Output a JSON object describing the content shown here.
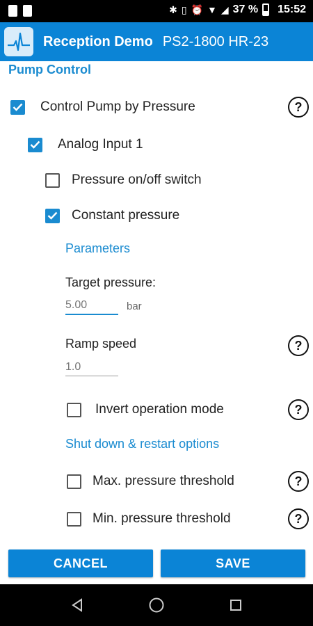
{
  "status_bar": {
    "battery": "37 %",
    "time": "15:52"
  },
  "app_bar": {
    "title": "Reception Demo",
    "device": "PS2-1800 HR-23"
  },
  "section_title": "Pump Control",
  "options": {
    "control_pump_by_pressure": {
      "label": "Control Pump by Pressure",
      "checked": true
    },
    "analog_input_1": {
      "label": "Analog Input 1",
      "checked": true
    },
    "pressure_switch": {
      "label": "Pressure on/off switch",
      "checked": false
    },
    "constant_pressure": {
      "label": "Constant pressure",
      "checked": true
    },
    "invert_operation": {
      "label": "Invert operation mode",
      "checked": false
    },
    "max_threshold": {
      "label": "Max. pressure threshold",
      "checked": false
    },
    "min_threshold": {
      "label": "Min. pressure threshold",
      "checked": false
    }
  },
  "parameters": {
    "heading": "Parameters",
    "target_pressure": {
      "label": "Target pressure:",
      "value": "5.00",
      "unit": "bar"
    },
    "ramp_speed": {
      "label": "Ramp speed",
      "value": "1.0"
    }
  },
  "shutdown_heading": "Shut down & restart options",
  "help_symbol": "?",
  "buttons": {
    "cancel": "CANCEL",
    "save": "SAVE"
  },
  "colors": {
    "accent": "#1a8bd0",
    "app_bar": "#0b84d6"
  }
}
